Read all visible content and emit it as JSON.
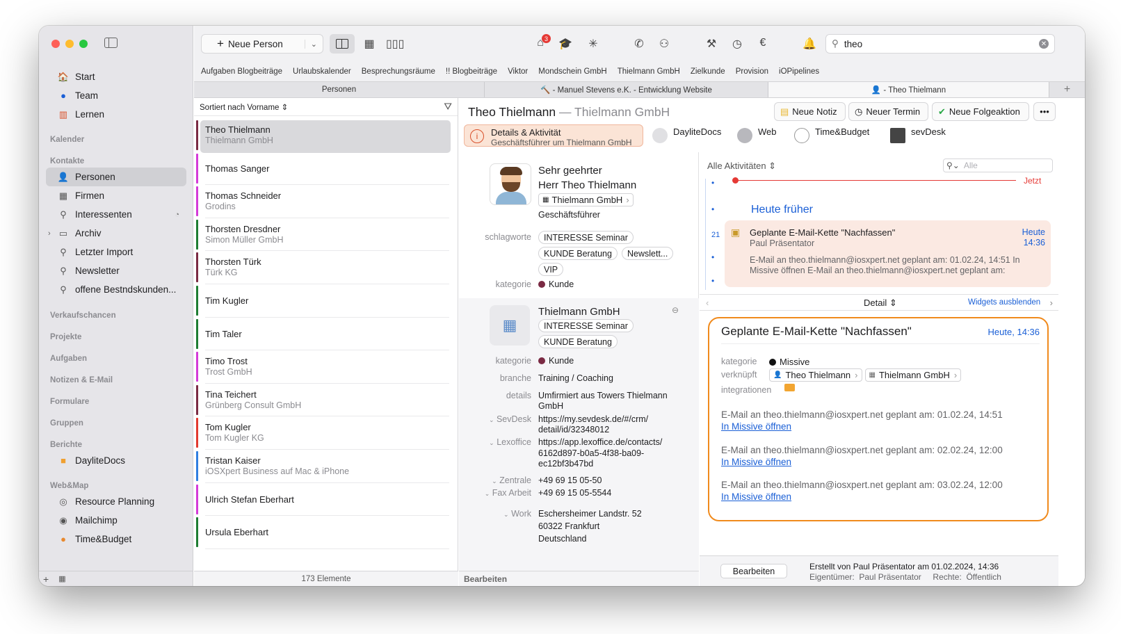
{
  "colors": {
    "accent": "#1a5fd6",
    "highlight": "#f08a1c",
    "selected_row": "#d9d9dc",
    "traffic": [
      "#fe5f57",
      "#febc2e",
      "#28c840"
    ]
  },
  "sidebar": {
    "items": [
      {
        "label": "Start",
        "icon": "house-icon"
      },
      {
        "label": "Team",
        "icon": "team-icon"
      },
      {
        "label": "Lernen",
        "icon": "books-icon"
      }
    ],
    "sections": {
      "kalender": "Kalender",
      "kontakte": "Kontakte",
      "verkaufschancen": "Verkaufschancen",
      "projekte": "Projekte",
      "aufgaben": "Aufgaben",
      "notizen": "Notizen & E-Mail",
      "formulare": "Formulare",
      "gruppen": "Gruppen",
      "berichte": "Berichte",
      "webmap": "Web&Map"
    },
    "contacts": [
      {
        "label": "Personen",
        "icon": "person-icon"
      },
      {
        "label": "Firmen",
        "icon": "building-icon"
      },
      {
        "label": "Interessenten",
        "icon": "person-group-icon"
      },
      {
        "label": "Archiv",
        "icon": "folder-icon"
      },
      {
        "label": "Letzter Import",
        "icon": "person-group-icon"
      },
      {
        "label": "Newsletter",
        "icon": "person-group-icon"
      },
      {
        "label": "offene Bestndskunden...",
        "icon": "person-group-icon"
      }
    ],
    "reports": [
      {
        "label": "DayliteDocs",
        "icon": "folder-icon"
      }
    ],
    "web": [
      {
        "label": "Resource Planning",
        "icon": "globe-icon"
      },
      {
        "label": "Mailchimp",
        "icon": "mailchimp-icon"
      },
      {
        "label": "Time&Budget",
        "icon": "timebudget-icon"
      }
    ]
  },
  "toolbar": {
    "new_person": "Neue Person",
    "search_value": "theo",
    "badge": "3"
  },
  "favorites": [
    "Aufgaben Blogbeiträge",
    "Urlaubskalender",
    "Besprechungsräume",
    "!! Blogbeiträge",
    "Viktor",
    "Mondschein GmbH",
    "Thielmann GmbH",
    "Zielkunde",
    "Provision",
    "iOPipelines"
  ],
  "tabs": [
    "Personen",
    "🔨 - Manuel Stevens e.K. - Entwicklung Website",
    "👤 - Theo Thielmann"
  ],
  "list": {
    "sort_label": "Sortiert nach Vorname ⇕",
    "footer": "173 Elemente",
    "rows": [
      {
        "name": "Theo Thielmann",
        "sub": "Thielmann GmbH",
        "color": "#7a2a43",
        "selected": true
      },
      {
        "name": "Thomas Sanger",
        "sub": "",
        "color": "#d43ad8"
      },
      {
        "name": "Thomas Schneider",
        "sub": "Grodins",
        "color": "#d43ad8"
      },
      {
        "name": "Thorsten Dresdner",
        "sub": "Simon Müller GmbH",
        "color": "#1e7d32"
      },
      {
        "name": "Thorsten Türk",
        "sub": "Türk KG",
        "color": "#7a2a43"
      },
      {
        "name": "Tim Kugler",
        "sub": "",
        "color": "#1e7d32"
      },
      {
        "name": "Tim Taler",
        "sub": "",
        "color": "#1e7d32"
      },
      {
        "name": "Timo Trost",
        "sub": "Trost GmbH",
        "color": "#d43ad8"
      },
      {
        "name": "Tina Teichert",
        "sub": "Grünberg Consult GmbH",
        "color": "#7a2a43"
      },
      {
        "name": "Tom Kugler",
        "sub": "Tom Kugler KG",
        "color": "#e2392f"
      },
      {
        "name": "Tristan Kaiser",
        "sub": "iOSXpert Business auf Mac & iPhone",
        "color": "#2f7ee0"
      },
      {
        "name": "Ulrich Stefan Eberhart",
        "sub": "",
        "color": "#d43ad8"
      },
      {
        "name": "Ursula Eberhart",
        "sub": "",
        "color": "#1e7d32"
      }
    ]
  },
  "detail": {
    "title": "Theo Thielmann",
    "company_title": "— Thielmann GmbH",
    "buttons": {
      "note": "Neue Notiz",
      "appointment": "Neuer Termin",
      "followup": "Neue Folgeaktion",
      "more": "•••"
    },
    "tabs": {
      "details": "Details & Aktivität",
      "details_sub": "Geschäftsführer um Thielmann GmbH",
      "daylitedocs": "DayliteDocs",
      "web": "Web",
      "timebudget": "Time&Budget",
      "sevdesk": "sevDesk"
    },
    "person": {
      "salutation": "Sehr geehrter",
      "name": "Herr Theo Thielmann",
      "company": "Thielmann GmbH",
      "role": "Geschäftsführer",
      "keywords_label": "schlagworte",
      "keywords": [
        "INTERESSE Seminar",
        "KUNDE Beratung",
        "Newslett...",
        "VIP"
      ],
      "category_label": "kategorie",
      "category": "Kunde"
    },
    "company": {
      "name": "Thielmann GmbH",
      "tags": [
        "INTERESSE Seminar",
        "KUNDE Beratung"
      ],
      "category_label": "kategorie",
      "category": "Kunde",
      "branch_label": "branche",
      "branch": "Training / Coaching",
      "details_label": "details",
      "details_1": "Umfirmiert aus Towers Thielmann",
      "details_2": "GmbH",
      "sevdesk_label": "SevDesk",
      "sevdesk_1": "https://my.sevdesk.de/#/crm/",
      "sevdesk_2": "detail/id/32348012",
      "lexoffice_label": "Lexoffice",
      "lexoffice_1": "https://app.lexoffice.de/contacts/",
      "lexoffice_2": "6162d897-b0a5-4f38-ba09-",
      "lexoffice_3": "ec12bf3b47bd",
      "zentrale_label": "Zentrale",
      "zentrale": "+49 69 15 05-50",
      "fax_label": "Fax Arbeit",
      "fax": "+49 69 15 05-5544",
      "work_label": "Work",
      "work_1": "Eschersheimer Landstr. 52",
      "work_2": "60322 Frankfurt",
      "work_3": "Deutschland"
    },
    "footer_edit": "Bearbeiten"
  },
  "activities": {
    "filter": "Alle Aktivitäten ⇕",
    "search_placeholder": "Alle",
    "now": "Jetzt",
    "earlier": "Heute früher",
    "day": "21",
    "card": {
      "title": "Geplante E-Mail-Kette \"Nachfassen\"",
      "author": "Paul Präsentator",
      "date": "Heute",
      "time": "14:36",
      "body_1": "E-Mail an theo.thielmann@iosxpert.net geplant am: 01.02.24, 14:51 In",
      "body_2": "Missive öffnen E-Mail an theo.thielmann@iosxpert.net geplant am:"
    },
    "detail_label": "Detail ⇕",
    "hide_widgets": "Widgets ausblenden",
    "popup": {
      "title": "Geplante E-Mail-Kette \"Nachfassen\"",
      "date": "Heute, 14:36",
      "kategorie_label": "kategorie",
      "kategorie": "Missive",
      "linked_label": "verknüpft",
      "linked_person": "Theo Thielmann",
      "linked_company": "Thielmann GmbH",
      "integrations_label": "integrationen",
      "mails": [
        {
          "text": "E-Mail an theo.thielmann@iosxpert.net geplant am: 01.02.24, 14:51",
          "link": "In Missive öffnen"
        },
        {
          "text": "E-Mail an theo.thielmann@iosxpert.net geplant am: 02.02.24, 12:00",
          "link": "In Missive öffnen"
        },
        {
          "text": "E-Mail an theo.thielmann@iosxpert.net geplant am: 03.02.24, 12:00",
          "link": "In Missive öffnen"
        }
      ]
    },
    "edit_button": "Bearbeiten",
    "created": "Erstellt von Paul Präsentator am 01.02.2024, 14:36",
    "owner": "Eigentümer:  Paul Präsentator     Rechte:  Öffentlich"
  }
}
